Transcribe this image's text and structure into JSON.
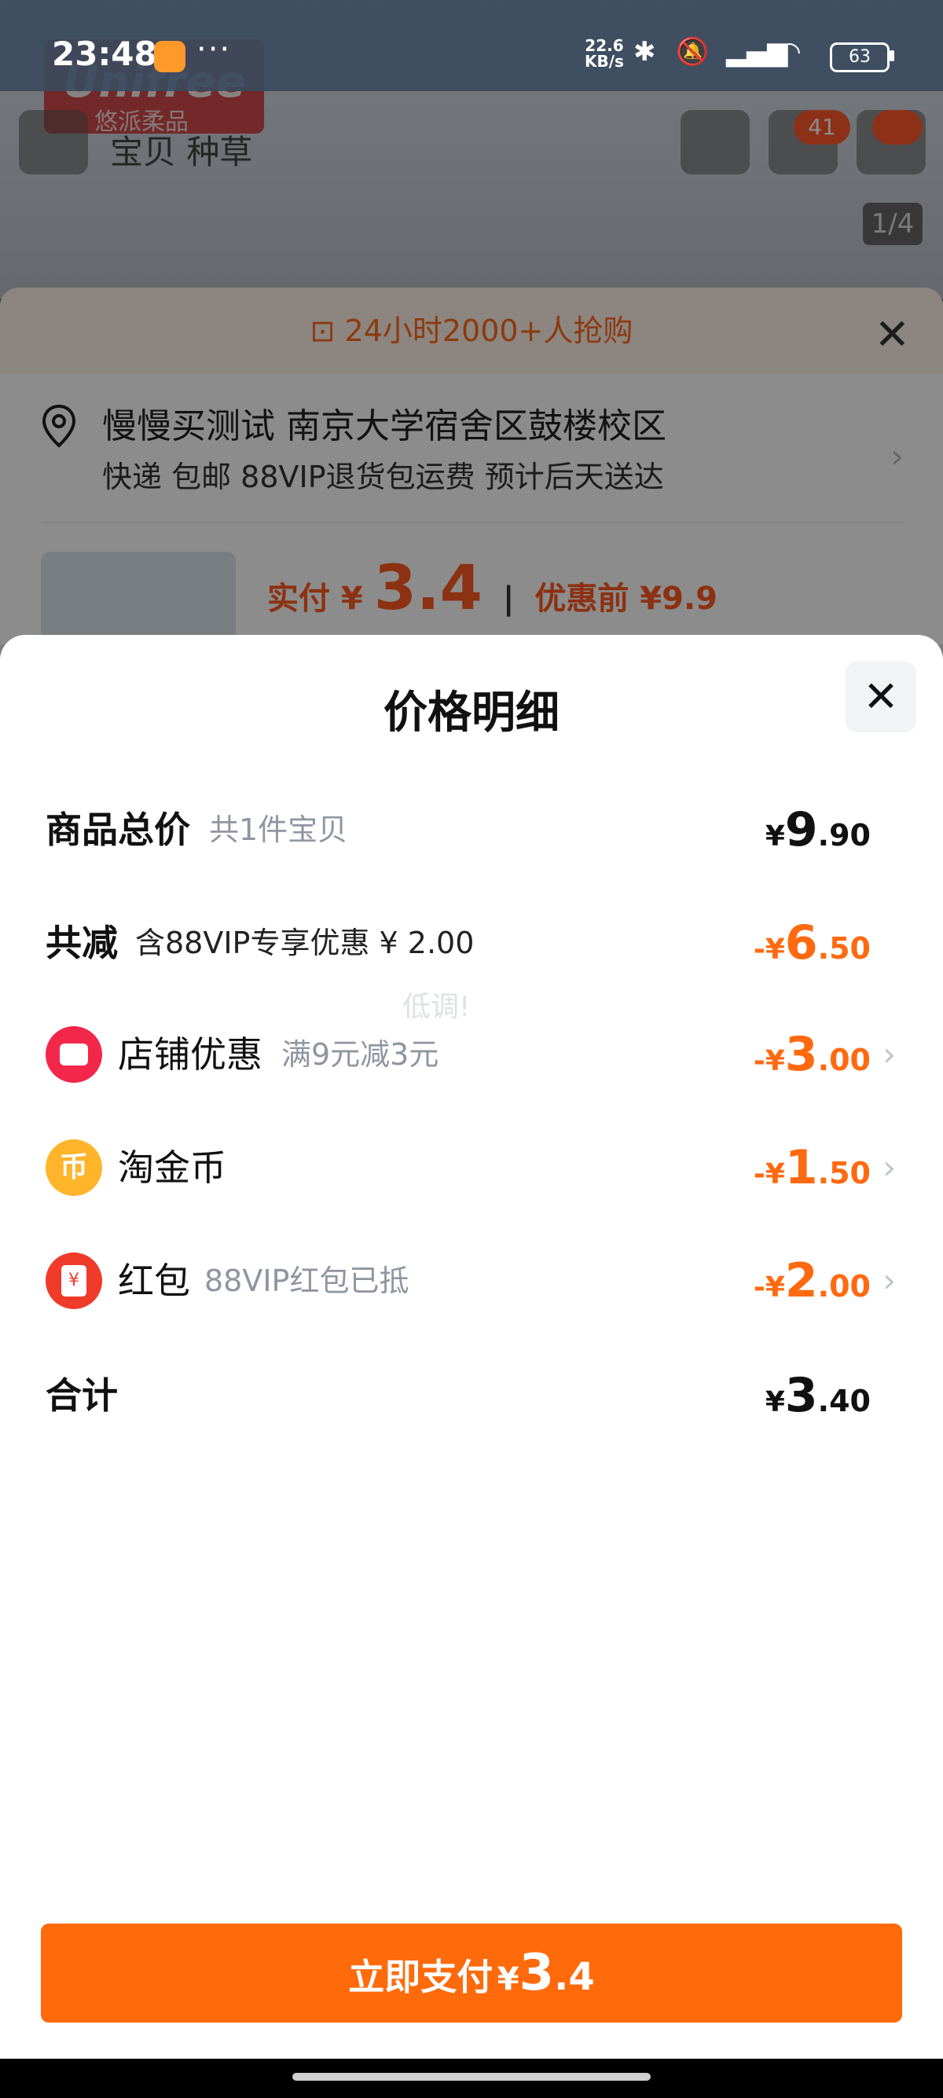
{
  "status_bar": {
    "time": "23:48",
    "dots": "···",
    "speed_value": "22.6",
    "speed_unit": "KB/s",
    "battery": "63"
  },
  "background": {
    "brand_text": "Unifree",
    "brand_sub": "悠派柔品",
    "tabs": "宝贝  种草",
    "cart_badge": "41",
    "image_pager": "1/4",
    "urgency": "24小时2000+人抢购",
    "address_line1": "慢慢买测试 南京大学宿舍区鼓楼校区",
    "address_line2": "快递 包邮 88VIP退货包运费 预计后天送达",
    "price_prefix": "实付 ¥",
    "price_main": "3.4",
    "price_before": "优惠前 ¥9.9"
  },
  "modal": {
    "title": "价格明细",
    "rows": [
      {
        "label": "商品总价",
        "sub": "共1件宝贝",
        "sym": "¥",
        "int": "9",
        "dec": ".90"
      },
      {
        "label": "共减",
        "sub": "含88VIP专享优惠 ¥ 2.00",
        "sym": "-¥",
        "int": "6",
        "dec": ".50"
      },
      {
        "label": "店铺优惠",
        "sub": "满9元减3元",
        "sym": "-¥",
        "int": "3",
        "dec": ".00"
      },
      {
        "label": "淘金币",
        "sub": "",
        "sym": "-¥",
        "int": "1",
        "dec": ".50"
      },
      {
        "label": "红包",
        "sub": "88VIP红包已抵",
        "sym": "-¥",
        "int": "2",
        "dec": ".00"
      },
      {
        "label": "合计",
        "sub": "",
        "sym": "¥",
        "int": "3",
        "dec": ".40"
      }
    ],
    "watermark": "低调!",
    "coin_glyph": "币",
    "hongbao_glyph": "¥"
  },
  "pay_button": {
    "label": "立即支付",
    "sym": "¥",
    "int": "3",
    "dec": ".4"
  },
  "colors": {
    "accent": "#ff6a0b",
    "discount_text": "#ff6a10",
    "secondary_text": "#8f96a0"
  }
}
